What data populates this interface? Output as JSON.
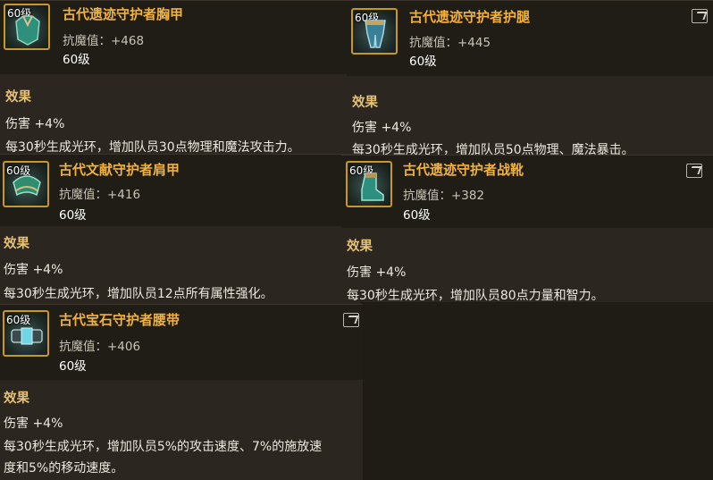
{
  "items": [
    {
      "level_badge": "60级",
      "name": "古代遗迹守护者胸甲",
      "stat": "抗魔值：+468",
      "level": "60级",
      "effect_title": "效果",
      "effect_lines": [
        "伤害 +4%",
        "每30秒生成光环，增加队员30点物理和魔法攻击力。"
      ],
      "icon": "chest-armor-icon"
    },
    {
      "level_badge": "60级",
      "name": "古代遗迹守护者护腿",
      "stat": "抗魔值：+445",
      "level": "60级",
      "effect_title": "效果",
      "effect_lines": [
        "伤害 +4%",
        "每30秒生成光环，增加队员50点物理、魔法暴击。"
      ],
      "icon": "leg-armor-icon"
    },
    {
      "level_badge": "60级",
      "name": "古代文献守护者肩甲",
      "stat": "抗魔值：+416",
      "level": "60级",
      "effect_title": "效果",
      "effect_lines": [
        "伤害 +4%",
        "每30秒生成光环，增加队员12点所有属性强化。"
      ],
      "icon": "shoulder-armor-icon"
    },
    {
      "level_badge": "60级",
      "name": "古代遗迹守护者战靴",
      "stat": "抗魔值：+382",
      "level": "60级",
      "effect_title": "效果",
      "effect_lines": [
        "伤害 +4%",
        "每30秒生成光环，增加队员80点力量和智力。"
      ],
      "icon": "boots-icon"
    },
    {
      "level_badge": "60级",
      "name": "古代宝石守护者腰带",
      "stat": "抗魔值：+406",
      "level": "60级",
      "effect_title": "效果",
      "effect_lines": [
        "伤害 +4%",
        "每30秒生成光环，增加队员5%的攻击速度、7%的施放速",
        "度和5%的移动速度。"
      ],
      "icon": "belt-icon"
    }
  ],
  "colors": {
    "name": "#f2b23c",
    "icon_border": "#c99722",
    "effect_title": "#e8c272"
  }
}
